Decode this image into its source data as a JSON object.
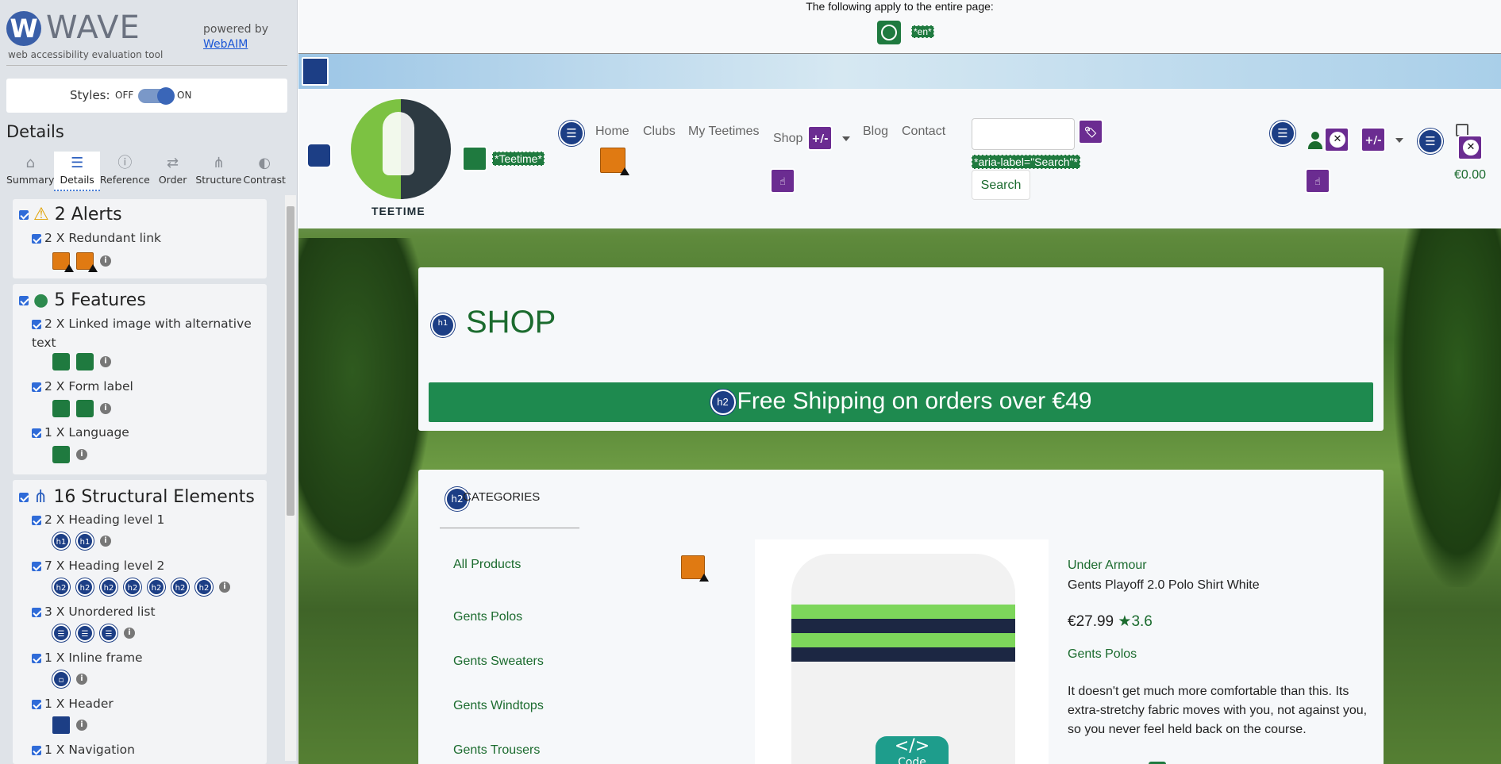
{
  "wave": {
    "logo_letter": "W",
    "title": "WAVE",
    "tagline": "web accessibility evaluation tool",
    "powered_by": "powered by",
    "webaim_link": "WebAIM",
    "styles_label": "Styles:",
    "styles_off": "OFF",
    "styles_on": "ON",
    "details_heading": "Details",
    "tabs": [
      {
        "label": "Summary",
        "icon": "home-icon",
        "glyph": "⌂"
      },
      {
        "label": "Details",
        "icon": "list-icon",
        "glyph": "☰"
      },
      {
        "label": "Reference",
        "icon": "info-icon",
        "glyph": "ⓘ"
      },
      {
        "label": "Order",
        "icon": "order-icon",
        "glyph": "⇄"
      },
      {
        "label": "Structure",
        "icon": "structure-icon",
        "glyph": "⋔"
      },
      {
        "label": "Contrast",
        "icon": "contrast-icon",
        "glyph": "◐"
      }
    ],
    "alerts": {
      "heading": "2 Alerts",
      "items": [
        {
          "label": "2 X Redundant link"
        }
      ]
    },
    "features": {
      "heading": "5 Features",
      "items": [
        {
          "label": "2 X Linked image with alternative",
          "label2": "text"
        },
        {
          "label": "2 X Form label"
        },
        {
          "label": "1 X Language"
        }
      ]
    },
    "structure": {
      "heading": "16 Structural Elements",
      "items": [
        {
          "label": "2 X Heading level 1",
          "icon_text": "h1"
        },
        {
          "label": "7 X Heading level 2",
          "icon_text": "h2"
        },
        {
          "label": "3 X Unordered list"
        },
        {
          "label": "1 X Inline frame"
        },
        {
          "label": "1 X Header"
        },
        {
          "label": "1 X Navigation"
        }
      ]
    }
  },
  "page": {
    "apply_text": "The following apply to the entire page:",
    "lang_tag": "*en*",
    "logo_alt_tag": "*Teetime*",
    "logo_text": "TEETIME",
    "nav": {
      "home": "Home",
      "clubs": "Clubs",
      "my_teetimes": "My Teetimes",
      "shop": "Shop",
      "blog": "Blog",
      "contact": "Contact"
    },
    "plusminus": "+/-",
    "search_aria": "*aria-label=\"Search\"*",
    "search_button": "Search",
    "cart_total": "€0.00",
    "h1_icon": "h1",
    "h2_icon": "h2",
    "shop_title": "SHOP",
    "banner": "Free Shipping on orders over €49",
    "categories_heading": "CATEGORIES",
    "categories": [
      "All Products",
      "Gents Polos",
      "Gents Sweaters",
      "Gents Windtops",
      "Gents Trousers"
    ],
    "product": {
      "brand": "Under Armour",
      "name": "Gents Playoff 2.0 Polo Shirt White",
      "price": "€27.99",
      "rating": "3.6",
      "category": "Gents Polos",
      "description": "It doesn't get much more comfortable than this. Its extra-stretchy fabric moves with you, not against you, so you never feel held back on the course.",
      "code_glyph": "</>",
      "code_label": "Code"
    }
  }
}
